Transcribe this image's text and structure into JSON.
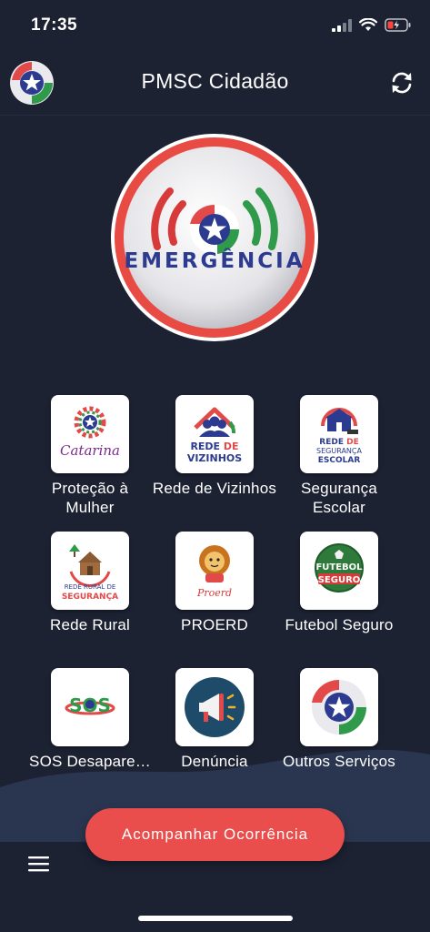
{
  "status": {
    "time": "17:35"
  },
  "header": {
    "title": "PMSC Cidadão",
    "logo_icon": "pmsc-star-logo-icon",
    "refresh_icon": "refresh-icon"
  },
  "emergency": {
    "label": "EMERGÊNCIA"
  },
  "services": [
    {
      "label": "Proteção à Mulher",
      "icon": "rede-catarina-icon",
      "icon_text": "Catarina"
    },
    {
      "label": "Rede de Vizinhos",
      "icon": "rede-de-vizinhos-icon",
      "icon_text": "REDE DE VIZINHOS"
    },
    {
      "label": "Segurança Escolar",
      "icon": "rede-seguranca-escolar-icon",
      "icon_text": "REDE DE SEGURANÇA ESCOLAR"
    },
    {
      "label": "Rede Rural",
      "icon": "rede-rural-icon",
      "icon_text": "REDE RURAL DE SEGURANÇA"
    },
    {
      "label": "PROERD",
      "icon": "proerd-lion-icon",
      "icon_text": "Proerd"
    },
    {
      "label": "Futebol Seguro",
      "icon": "futebol-seguro-icon",
      "icon_text": "FUTEBOL SEGURO"
    },
    {
      "label": "SOS Desapare…",
      "icon": "sos-desaparecidos-icon",
      "icon_text": "SOS"
    },
    {
      "label": "Denúncia",
      "icon": "megaphone-icon"
    },
    {
      "label": "Outros Serviços",
      "icon": "pmsc-star-logo-icon"
    }
  ],
  "cta": {
    "label": "Acompanhar Ocorrência"
  },
  "colors": {
    "background": "#1d2233",
    "accent_red": "#ea4e4c",
    "brand_blue": "#2c3b8f",
    "brand_green": "#2e9a4a"
  }
}
